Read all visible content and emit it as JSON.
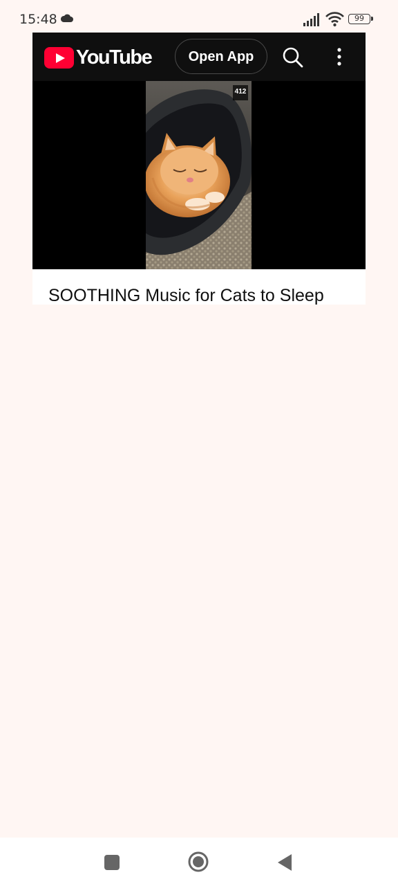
{
  "status_bar": {
    "time": "15:48",
    "battery": "99",
    "icons": [
      "cloud-icon",
      "signal-icon",
      "wifi-icon",
      "battery-icon"
    ]
  },
  "header": {
    "logo_text": "YouTube",
    "open_app_label": "Open App",
    "icons": [
      "search-icon",
      "more-vert-icon"
    ]
  },
  "video": {
    "overlay_badge": "412",
    "title": "SOOTHING Music for Cats to Sleep"
  },
  "nav_bar": {
    "icons": [
      "recents-icon",
      "home-icon",
      "back-icon"
    ]
  },
  "colors": {
    "page_background": "#fff6f3",
    "header_background": "#0f0f0f",
    "brand_red": "#ff0033"
  }
}
